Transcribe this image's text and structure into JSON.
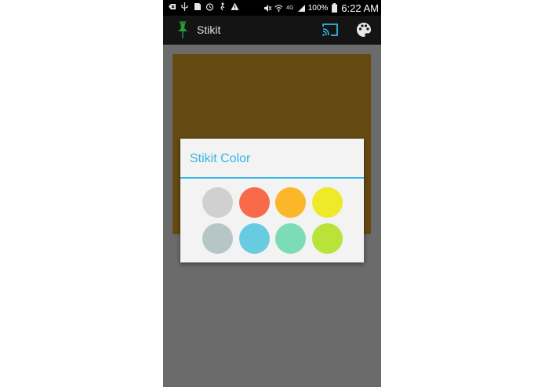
{
  "status_bar": {
    "battery_percent": "100%",
    "time": "6:22 AM",
    "network": "4G"
  },
  "app_bar": {
    "title": "Stikit",
    "icons": [
      "pushpin-icon",
      "cast-icon",
      "palette-icon"
    ]
  },
  "note": {
    "color": "#654a12"
  },
  "dialog": {
    "title": "Stikit Color",
    "accent_color": "#33b5e5",
    "swatches": [
      {
        "color": "#d0d0d0"
      },
      {
        "color": "#f96a4b"
      },
      {
        "color": "#fbb62a"
      },
      {
        "color": "#eeea2a"
      },
      {
        "color": "#b6c5c6"
      },
      {
        "color": "#67cce0"
      },
      {
        "color": "#7ddcb8"
      },
      {
        "color": "#b9e338"
      }
    ]
  }
}
